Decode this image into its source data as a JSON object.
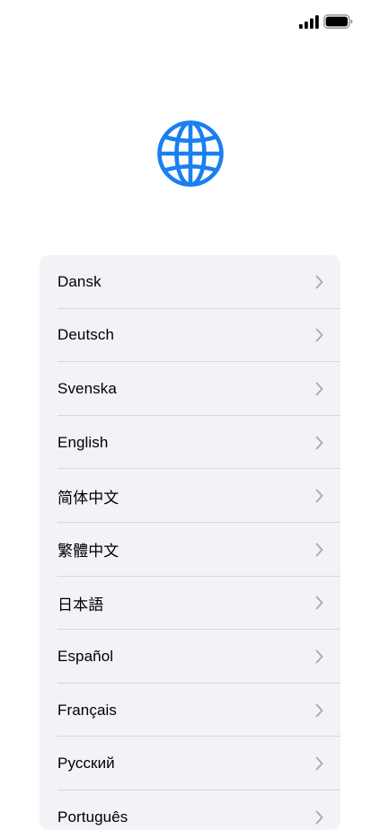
{
  "status_bar": {
    "signal_icon": "cellular-signal-icon",
    "battery_icon": "battery-icon"
  },
  "header": {
    "icon": "globe-icon",
    "accent_color": "#1a7ff0"
  },
  "languages": [
    {
      "label": "Dansk"
    },
    {
      "label": "Deutsch"
    },
    {
      "label": "Svenska"
    },
    {
      "label": "English"
    },
    {
      "label": "简体中文"
    },
    {
      "label": "繁體中文"
    },
    {
      "label": "日本語"
    },
    {
      "label": "Español"
    },
    {
      "label": "Français"
    },
    {
      "label": "Русский"
    },
    {
      "label": "Português"
    }
  ],
  "item_icon": "chevron-right-icon"
}
